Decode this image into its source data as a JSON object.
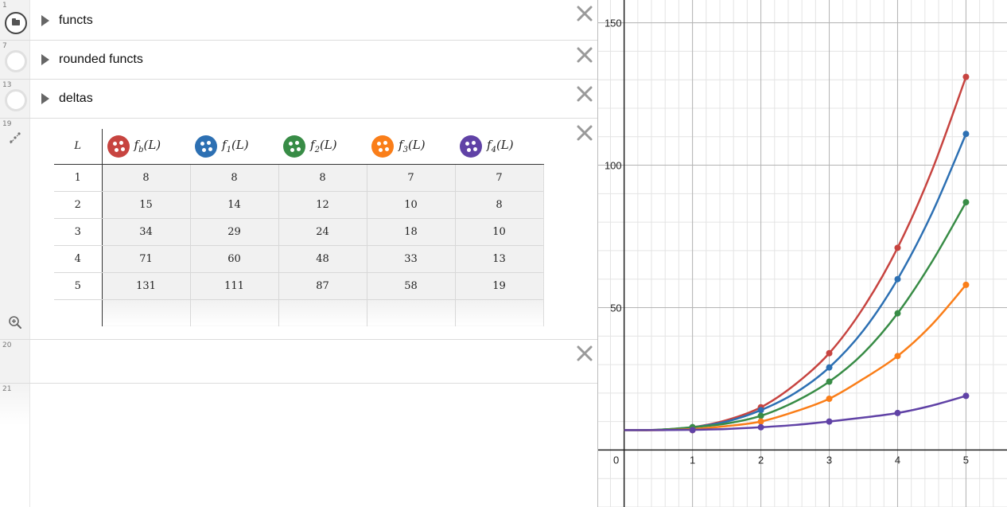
{
  "expressions": [
    {
      "num": "1",
      "type": "folder",
      "title": "functs",
      "active": true
    },
    {
      "num": "7",
      "type": "folder",
      "title": "rounded functs",
      "active": false
    },
    {
      "num": "13",
      "type": "folder",
      "title": "deltas",
      "active": false
    },
    {
      "num": "19",
      "type": "table"
    },
    {
      "num": "20",
      "type": "empty"
    },
    {
      "num": "21",
      "type": "new"
    }
  ],
  "icons": {
    "folder_toggle": "folder-icon",
    "caret": "caret-right-icon",
    "close": "close-icon",
    "table": "table-icon",
    "zoom": "zoom-in-icon",
    "column_color": "dot-cluster-icon"
  },
  "table": {
    "l_header": "L",
    "columns": [
      {
        "name": "f",
        "sub": "b",
        "arg": "(L)",
        "color": "#c74440"
      },
      {
        "name": "f",
        "sub": "1",
        "arg": "(L)",
        "color": "#2d70b3"
      },
      {
        "name": "f",
        "sub": "2",
        "arg": "(L)",
        "color": "#388c46"
      },
      {
        "name": "f",
        "sub": "3",
        "arg": "(L)",
        "color": "#fa7e19"
      },
      {
        "name": "f",
        "sub": "4",
        "arg": "(L)",
        "color": "#6042a6"
      }
    ],
    "rows": [
      {
        "L": "1",
        "values": [
          "8",
          "8",
          "8",
          "7",
          "7"
        ]
      },
      {
        "L": "2",
        "values": [
          "15",
          "14",
          "12",
          "10",
          "8"
        ]
      },
      {
        "L": "3",
        "values": [
          "34",
          "29",
          "24",
          "18",
          "10"
        ]
      },
      {
        "L": "4",
        "values": [
          "71",
          "60",
          "48",
          "33",
          "13"
        ]
      },
      {
        "L": "5",
        "values": [
          "131",
          "111",
          "87",
          "58",
          "19"
        ]
      }
    ]
  },
  "chart_data": {
    "type": "line",
    "x_ticks": [
      "0",
      "1",
      "2",
      "3",
      "4",
      "5"
    ],
    "y_ticks": [
      "50",
      "100",
      "150"
    ],
    "xlim": [
      -0.38,
      5.6
    ],
    "ylim": [
      -20,
      158
    ],
    "grid": true,
    "series": [
      {
        "color": "#c74440",
        "x": [
          1,
          2,
          3,
          4,
          5
        ],
        "y": [
          8,
          15,
          34,
          71,
          131
        ],
        "curve": [
          [
            0,
            7
          ],
          [
            0.5,
            7.1
          ],
          [
            1,
            8
          ],
          [
            1.5,
            10.5
          ],
          [
            2,
            15
          ],
          [
            2.5,
            23
          ],
          [
            3,
            34
          ],
          [
            3.5,
            50
          ],
          [
            4,
            71
          ],
          [
            4.5,
            98
          ],
          [
            5,
            131
          ]
        ]
      },
      {
        "color": "#2d70b3",
        "x": [
          1,
          2,
          3,
          4,
          5
        ],
        "y": [
          8,
          14,
          29,
          60,
          111
        ],
        "curve": [
          [
            0,
            7
          ],
          [
            0.5,
            7.1
          ],
          [
            1,
            8
          ],
          [
            1.5,
            10
          ],
          [
            2,
            14
          ],
          [
            2.5,
            20
          ],
          [
            3,
            29
          ],
          [
            3.5,
            42
          ],
          [
            4,
            60
          ],
          [
            4.5,
            83
          ],
          [
            5,
            111
          ]
        ]
      },
      {
        "color": "#388c46",
        "x": [
          1,
          2,
          3,
          4,
          5
        ],
        "y": [
          8,
          12,
          24,
          48,
          87
        ],
        "curve": [
          [
            0,
            7
          ],
          [
            0.5,
            7.1
          ],
          [
            1,
            8
          ],
          [
            1.5,
            9.3
          ],
          [
            2,
            12
          ],
          [
            2.5,
            17
          ],
          [
            3,
            24
          ],
          [
            3.5,
            34
          ],
          [
            4,
            48
          ],
          [
            4.5,
            66
          ],
          [
            5,
            87
          ]
        ]
      },
      {
        "color": "#fa7e19",
        "x": [
          1,
          2,
          3,
          4,
          5
        ],
        "y": [
          7,
          10,
          18,
          33,
          58
        ],
        "curve": [
          [
            0,
            7
          ],
          [
            0.5,
            7
          ],
          [
            1,
            7.4
          ],
          [
            1.5,
            8.4
          ],
          [
            2,
            10
          ],
          [
            2.5,
            13.5
          ],
          [
            3,
            18
          ],
          [
            3.5,
            25
          ],
          [
            4,
            33
          ],
          [
            4.5,
            44
          ],
          [
            5,
            58
          ]
        ]
      },
      {
        "color": "#6042a6",
        "x": [
          1,
          2,
          3,
          4,
          5
        ],
        "y": [
          7,
          8,
          10,
          13,
          19
        ],
        "curve": [
          [
            0,
            7
          ],
          [
            0.5,
            7
          ],
          [
            1,
            7.1
          ],
          [
            1.5,
            7.4
          ],
          [
            2,
            8
          ],
          [
            2.5,
            8.8
          ],
          [
            3,
            10
          ],
          [
            3.5,
            11.4
          ],
          [
            4,
            13
          ],
          [
            4.5,
            15.6
          ],
          [
            5,
            19
          ]
        ]
      }
    ]
  }
}
